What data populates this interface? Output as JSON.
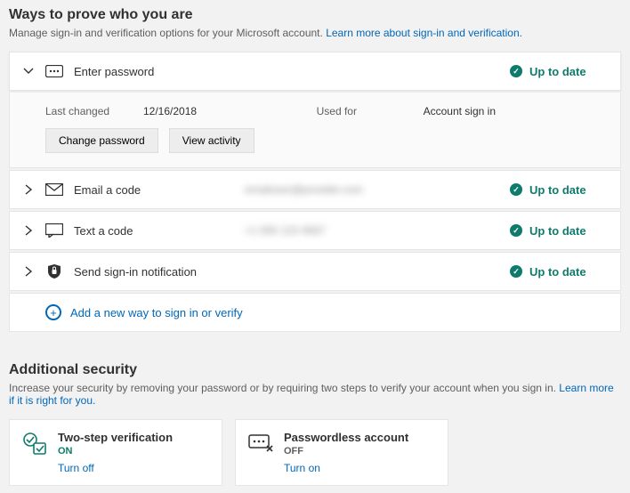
{
  "ways": {
    "title": "Ways to prove who you are",
    "subtitle_plain": "Manage sign-in and verification options for your Microsoft account. ",
    "subtitle_link": "Learn more about sign-in and verification.",
    "status_label": "Up to date",
    "password": {
      "title": "Enter password",
      "last_changed_label": "Last changed",
      "last_changed_value": "12/16/2018",
      "used_for_label": "Used for",
      "used_for_value": "Account sign in",
      "change_btn": "Change password",
      "activity_btn": "View activity"
    },
    "email": {
      "title": "Email a code",
      "value": "emailuser@provider.com"
    },
    "text": {
      "title": "Text a code",
      "value": "+1 555 123 4567"
    },
    "notif": {
      "title": "Send sign-in notification"
    },
    "add": "Add a new way to sign in or verify"
  },
  "additional": {
    "title": "Additional security",
    "subtitle_plain": "Increase your security by removing your password or by requiring two steps to verify your account when you sign in. ",
    "subtitle_link": "Learn more if it is right for you.",
    "twostep": {
      "title": "Two-step verification",
      "state": "ON",
      "action": "Turn off"
    },
    "passwordless": {
      "title": "Passwordless account",
      "state": "OFF",
      "action": "Turn on"
    }
  }
}
